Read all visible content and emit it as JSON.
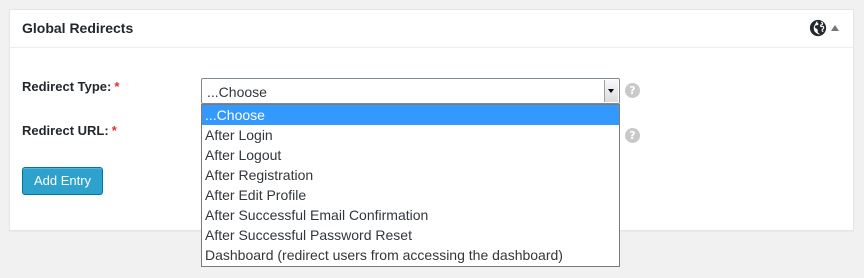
{
  "panel": {
    "title": "Global Redirects",
    "header_icons": [
      "globe-icon",
      "toggle-arrow-up-icon"
    ]
  },
  "form": {
    "redirect_type": {
      "label": "Redirect Type:",
      "required_mark": "*",
      "selected_value": "...Choose",
      "help_icon": "question-mark-icon"
    },
    "redirect_url": {
      "label": "Redirect URL:",
      "required_mark": "*",
      "help_icon": "question-mark-icon"
    },
    "add_button_label": "Add Entry"
  },
  "dropdown": {
    "options": [
      "...Choose",
      "After Login",
      "After Logout",
      "After Registration",
      "After Edit Profile",
      "After Successful Email Confirmation",
      "After Successful Password Reset",
      "Dashboard (redirect users from accessing the dashboard)"
    ],
    "highlighted": "...Choose"
  },
  "colors": {
    "accent_button": "#2ea2cc",
    "highlight": "#3399ff",
    "required": "#dc3232"
  }
}
